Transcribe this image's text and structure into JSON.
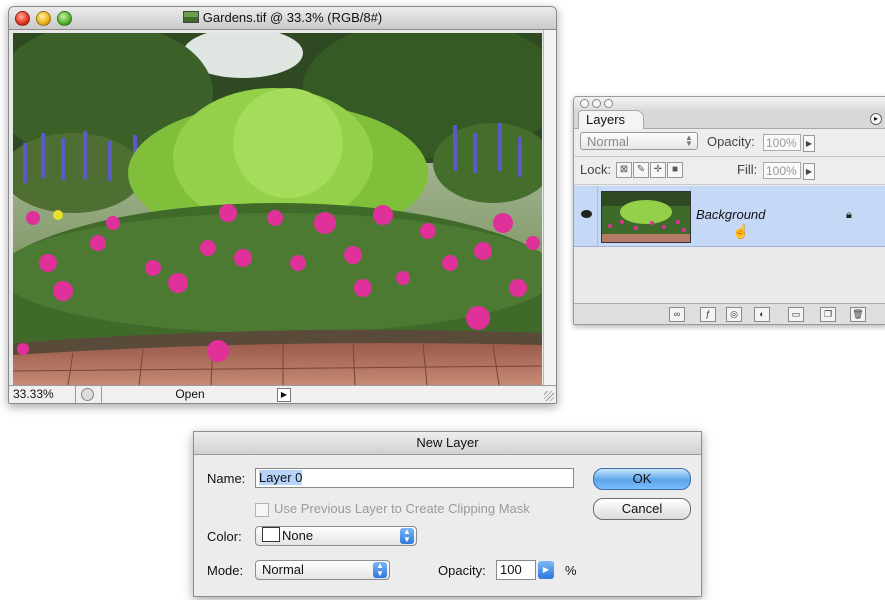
{
  "document": {
    "title": "Gardens.tif @ 33.3% (RGB/8#)",
    "zoom": "33.33%",
    "status": "Open"
  },
  "layers_panel": {
    "tab": "Layers",
    "blend_mode": "Normal",
    "opacity_label": "Opacity:",
    "opacity_value": "100%",
    "lock_label": "Lock:",
    "fill_label": "Fill:",
    "fill_value": "100%",
    "layer_name": "Background"
  },
  "new_layer_dialog": {
    "title": "New Layer",
    "name_label": "Name:",
    "name_value": "Layer 0",
    "clipping_label": "Use Previous Layer to Create Clipping Mask",
    "color_label": "Color:",
    "color_value": "None",
    "mode_label": "Mode:",
    "mode_value": "Normal",
    "opacity_label": "Opacity:",
    "opacity_value": "100",
    "percent": "%",
    "ok_label": "OK",
    "cancel_label": "Cancel"
  },
  "colors": {
    "selection": "#c5d9f7",
    "default_button": "#5aa4ea"
  }
}
